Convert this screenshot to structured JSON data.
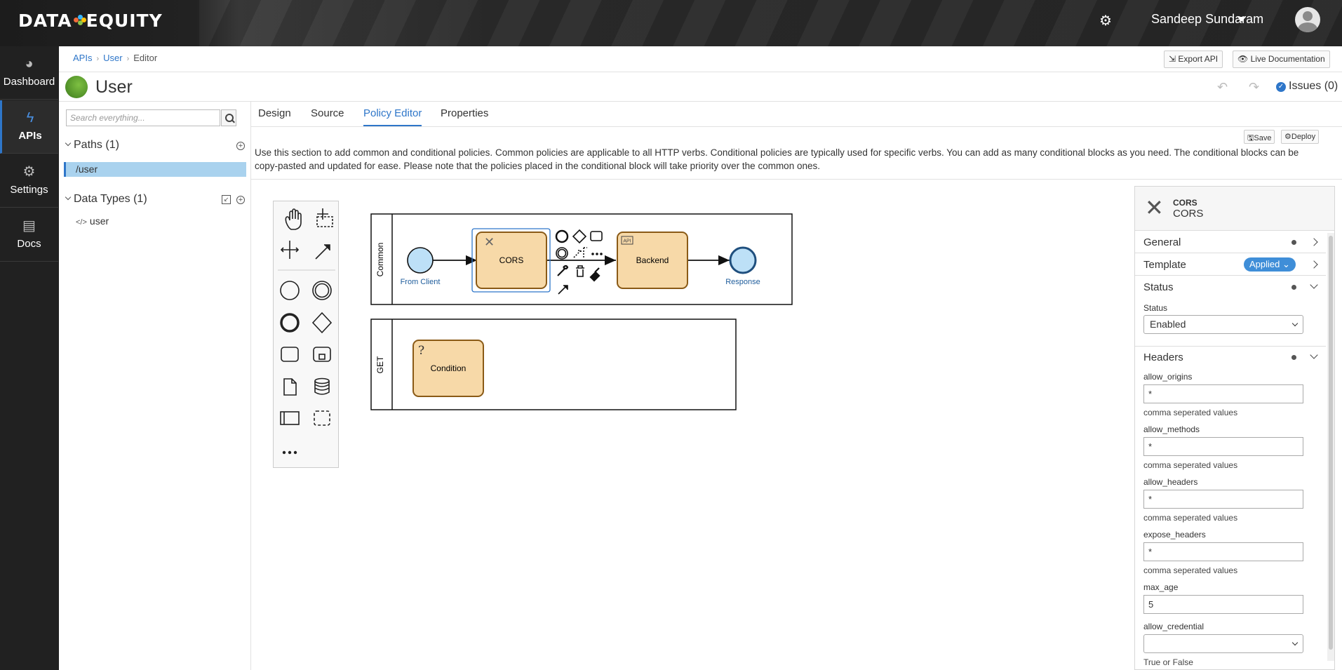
{
  "topbar": {
    "brand_left": "DATA",
    "brand_right": "EQUITY",
    "user_name": "Sandeep Sundaram"
  },
  "nav": {
    "items": [
      {
        "label": "Dashboard",
        "icon": "dashboard-icon"
      },
      {
        "label": "APIs",
        "icon": "bolt-icon",
        "active": true
      },
      {
        "label": "Settings",
        "icon": "gears-icon"
      },
      {
        "label": "Docs",
        "icon": "book-icon"
      }
    ]
  },
  "breadcrumb": {
    "items": [
      "APIs",
      "User",
      "Editor"
    ]
  },
  "header": {
    "export_label": "Export API",
    "live_docs_label": "Live Documentation",
    "api_title": "User",
    "issues_label": "Issues (0)"
  },
  "sidebar": {
    "search_placeholder": "Search everything...",
    "paths_title": "Paths (1)",
    "paths": [
      "/user"
    ],
    "datatypes_title": "Data Types (1)",
    "datatypes": [
      "user"
    ]
  },
  "tabs": [
    "Design",
    "Source",
    "Policy Editor",
    "Properties"
  ],
  "active_tab": "Policy Editor",
  "editor": {
    "save_label": "Save",
    "deploy_label": "Deploy",
    "description": "Use this section to add common and conditional policies. Common policies are applicable to all HTTP verbs. Conditional policies are typically used for specific verbs. You can add as many conditional blocks as you need. The conditional blocks can be copy-pasted and updated for ease. Please note that the policies placed in the conditional block will take priority over the common ones."
  },
  "diagram": {
    "lane_common": "Common",
    "lane_get": "GET",
    "start_label": "From Client",
    "cors_label": "CORS",
    "backend_label": "Backend",
    "api_tag": "API",
    "end_label": "Response",
    "condition_label": "Condition"
  },
  "props": {
    "head_title": "CORS",
    "head_subtitle": "CORS",
    "general_label": "General",
    "template_label": "Template",
    "template_badge": "Applied",
    "status_group_label": "Status",
    "status_field_label": "Status",
    "status_value": "Enabled",
    "headers_group_label": "Headers",
    "fields": [
      {
        "label": "allow_origins",
        "value": "*",
        "help": "comma seperated values"
      },
      {
        "label": "allow_methods",
        "value": "*",
        "help": "comma seperated values"
      },
      {
        "label": "allow_headers",
        "value": "*",
        "help": "comma seperated values"
      },
      {
        "label": "expose_headers",
        "value": "*",
        "help": "comma seperated values"
      },
      {
        "label": "max_age",
        "value": "5"
      }
    ],
    "credential_label": "allow_credential",
    "credential_value": "",
    "credential_help": "True or False"
  },
  "colors": {
    "accent": "#2e76c9",
    "task_fill": "#f7d9a8",
    "task_stroke": "#8a5a16",
    "event_fill": "#bde0f7",
    "path_bg": "#a9d2ee"
  }
}
